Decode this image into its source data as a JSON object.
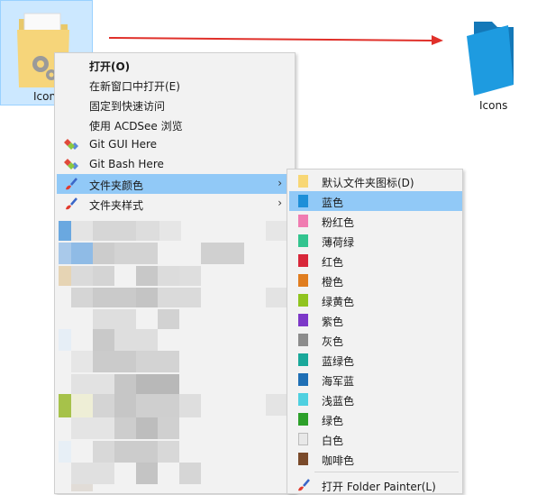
{
  "desktop": {
    "folder_label": "Icons",
    "target_label": "Icons"
  },
  "menu": {
    "items": [
      {
        "label": "打开(O)",
        "bold": true
      },
      {
        "label": "在新窗口中打开(E)"
      },
      {
        "label": "固定到快速访问"
      },
      {
        "label": "使用 ACDSee 浏览"
      },
      {
        "label": "Git GUI Here"
      },
      {
        "label": "Git Bash Here"
      },
      {
        "label": "文件夹颜色"
      },
      {
        "label": "文件夹样式"
      }
    ],
    "chevron": "›"
  },
  "submenu": {
    "items": [
      {
        "label": "默认文件夹图标(D)",
        "color": "#f8d775"
      },
      {
        "label": "蓝色",
        "color": "#1e8fd8"
      },
      {
        "label": "粉红色",
        "color": "#f07cb1"
      },
      {
        "label": "薄荷绿",
        "color": "#33c48f"
      },
      {
        "label": "红色",
        "color": "#d8273a"
      },
      {
        "label": "橙色",
        "color": "#e07d1f"
      },
      {
        "label": "绿黄色",
        "color": "#90c41f"
      },
      {
        "label": "紫色",
        "color": "#7c38c8"
      },
      {
        "label": "灰色",
        "color": "#8c8c8c"
      },
      {
        "label": "蓝绿色",
        "color": "#1aa89a"
      },
      {
        "label": "海军蓝",
        "color": "#1f6fb5"
      },
      {
        "label": "浅蓝色",
        "color": "#4fd0e0"
      },
      {
        "label": "绿色",
        "color": "#2da02a"
      },
      {
        "label": "白色",
        "color": "#e8e8e8"
      },
      {
        "label": "咖啡色",
        "color": "#7a4a2a"
      }
    ],
    "footer": "打开 Folder Painter(L)"
  },
  "colors": {
    "highlight": "#91c9f7",
    "arrow": "#e0302a",
    "folder_blue": "#1e9be0"
  }
}
